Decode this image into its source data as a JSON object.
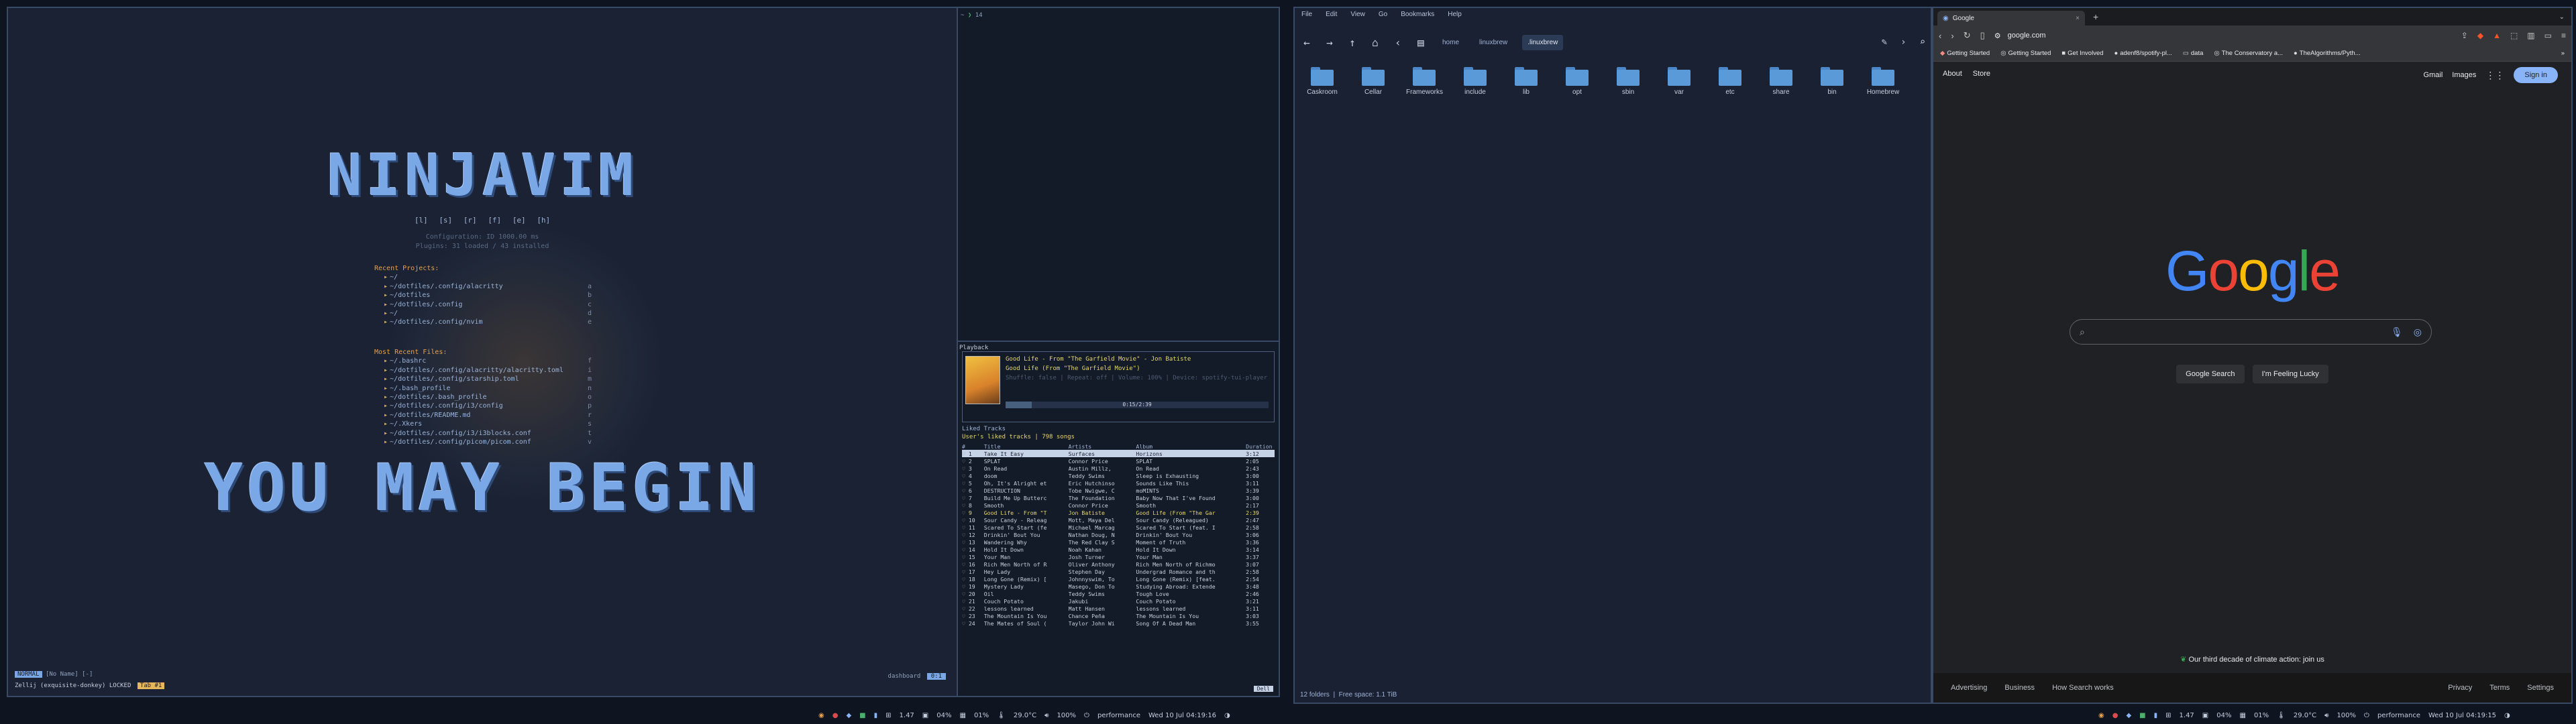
{
  "nvim": {
    "title_top": "NINJAVIM",
    "title_bottom": "YOU MAY BEGIN",
    "shortcuts": [
      "[l]",
      "[s]",
      "[r]",
      "[f]",
      "[e]",
      "[h]"
    ],
    "info_line1": "Configuration: ID 1000.00 ms",
    "info_line2": "Plugins: 31 loaded / 43 installed",
    "recent_header": "Recent Projects:",
    "recent": [
      {
        "path": "~/",
        "key": ""
      },
      {
        "path": "~/dotfiles/.config/alacritty",
        "key": "a"
      },
      {
        "path": "~/dotfiles",
        "key": "b"
      },
      {
        "path": "~/dotfiles/.config",
        "key": "c"
      },
      {
        "path": "~/",
        "key": "d"
      },
      {
        "path": "~/dotfiles/.config/nvim",
        "key": "e"
      }
    ],
    "mru_header": "Most Recent Files:",
    "mru": [
      {
        "path": "~/.bashrc",
        "key": "f"
      },
      {
        "path": "~/dotfiles/.config/alacritty/alacritty.toml",
        "key": "i"
      },
      {
        "path": "~/dotfiles/.config/starship.toml",
        "key": "m"
      },
      {
        "path": "~/.bash_profile",
        "key": "n"
      },
      {
        "path": "~/dotfiles/.bash_profile",
        "key": "o"
      },
      {
        "path": "~/dotfiles/.config/i3/config",
        "key": "p"
      },
      {
        "path": "~/dotfiles/README.md",
        "key": "r"
      },
      {
        "path": "~/.Xkers",
        "key": "s"
      },
      {
        "path": "~/dotfiles/.config/i3/i3blocks.conf",
        "key": "t"
      },
      {
        "path": "~/dotfiles/.config/picom/picom.conf",
        "key": "v"
      }
    ],
    "mode": "NORMAL",
    "buffer": "[No Name] [-]",
    "session": "Zellij (exquisite-donkey) LOCKED",
    "session_tag": "Tab #1",
    "right_label": "dashboard",
    "position": "0:1"
  },
  "terminal": {
    "prompt_dir": "~",
    "prompt_count": "14"
  },
  "spotify": {
    "box_label": "Playback",
    "line1": "Good Life - From \"The Garfield Movie\" - Jon Batiste",
    "line2": "Good Life (From \"The Garfield Movie\")",
    "line3": "Shuffle: false | Repeat: off | Volume: 100% | Device: spotify-tui-player",
    "progress_text": "0:15/2:39",
    "progress_fraction": 0.1,
    "lib_title": "Liked Tracks",
    "lib_sub": "User's liked tracks | 798 songs",
    "columns": [
      "#",
      "Title",
      "Artists",
      "Album",
      "Duration"
    ],
    "tracks": [
      [
        "1",
        "Take It Easy",
        "Surfaces",
        "Horizons",
        "3:12"
      ],
      [
        "2",
        "SPLAT",
        "Connor Price",
        "SPLAT",
        "2:05"
      ],
      [
        "3",
        "On Read",
        "Austin Millz,",
        "On Read",
        "2:43"
      ],
      [
        "4",
        "doom",
        "Teddy Swims",
        "Sleep is Exhausting",
        "3:00"
      ],
      [
        "5",
        "Oh, It's Alright et",
        "Eric Hutchinso",
        "Sounds Like This",
        "3:11"
      ],
      [
        "6",
        "DESTRUCTION",
        "Tobe Nwigwe, C",
        "moMINTS",
        "3:39"
      ],
      [
        "7",
        "Build Me Up Butterc",
        "The Foundation",
        "Baby Now That I've Found",
        "3:00"
      ],
      [
        "8",
        "Smooth",
        "Connor Price",
        "Smooth",
        "2:17"
      ],
      [
        "9",
        "Good Life - From \"T",
        "Jon Batiste",
        "Good Life (From \"The Gar",
        "2:39"
      ],
      [
        "10",
        "Sour Candy - Releag",
        "Mott, Maya Del",
        "Sour Candy (Releagued)",
        "2:47"
      ],
      [
        "11",
        "Scared To Start (fe",
        "Michael Marcag",
        "Scared To Start (feat. I",
        "2:58"
      ],
      [
        "12",
        "Drinkin' Bout You",
        "Nathan Doug, N",
        "Drinkin' Bout You",
        "3:06"
      ],
      [
        "13",
        "Wandering Why",
        "The Red Clay S",
        "Moment of Truth",
        "3:36"
      ],
      [
        "14",
        "Hold It Down",
        "Noah Kahan",
        "Hold It Down",
        "3:14"
      ],
      [
        "15",
        "Your Man",
        "Josh Turner",
        "Your Man",
        "3:37"
      ],
      [
        "16",
        "Rich Men North of R",
        "Oliver Anthony",
        "Rich Men North of Richmo",
        "3:07"
      ],
      [
        "17",
        "Hey Lady",
        "Stephen Day",
        "Undergrad Romance and th",
        "2:58"
      ],
      [
        "18",
        "Long Gone (Remix) [",
        "Johnnyswim, To",
        "Long Gone (Remix) [feat.",
        "2:54"
      ],
      [
        "19",
        "Mystery Lady",
        "Masego, Don To",
        "Studying Abroad: Extende",
        "3:48"
      ],
      [
        "20",
        "Oil",
        "Teddy Swims",
        "Tough Love",
        "2:46"
      ],
      [
        "21",
        "Couch Potato",
        "Jakubi",
        "Couch Potato",
        "3:21"
      ],
      [
        "22",
        "lessons learned",
        "Matt Hansen",
        "lessons learned",
        "3:11"
      ],
      [
        "23",
        "The Mountain Is You",
        "Chance Peña",
        "The Mountain Is You",
        "3:03"
      ],
      [
        "24",
        "The Mates of Soul (",
        "Taylor John Wi",
        "Song Of A Dead Man",
        "3:55"
      ]
    ],
    "selected_index": 0,
    "playing_index": 8,
    "footer": "Dell"
  },
  "files": {
    "menu": [
      "File",
      "Edit",
      "View",
      "Go",
      "Bookmarks",
      "Help"
    ],
    "crumbs": [
      "home",
      "linuxbrew",
      ".linuxbrew"
    ],
    "folders": [
      "Caskroom",
      "Cellar",
      "Frameworks",
      "include",
      "lib",
      "opt",
      "sbin",
      "var",
      "etc",
      "share",
      "bin",
      "Homebrew"
    ],
    "status_count": "12 folders",
    "status_free": "Free space: 1.1 TiB"
  },
  "chrome": {
    "tab_title": "Google",
    "url": "google.com",
    "bookmarks": [
      "Getting Started",
      "Getting Started",
      "Get Involved",
      "adenf8/spotify-pl...",
      "data",
      "The Conservatory a...",
      "TheAlgorithms/Pyth..."
    ],
    "top_left": [
      "About",
      "Store"
    ],
    "top_right": [
      "Gmail",
      "Images"
    ],
    "signin": "Sign in",
    "logo_letters": [
      {
        "ch": "G",
        "color": "#4285f4"
      },
      {
        "ch": "o",
        "color": "#ea4335"
      },
      {
        "ch": "o",
        "color": "#fbbc05"
      },
      {
        "ch": "g",
        "color": "#4285f4"
      },
      {
        "ch": "l",
        "color": "#34a853"
      },
      {
        "ch": "e",
        "color": "#ea4335"
      }
    ],
    "btn_search": "Google Search",
    "btn_lucky": "I'm Feeling Lucky",
    "climate": "Our third decade of climate action: join us",
    "footer_left": [
      "Advertising",
      "Business",
      "How Search works"
    ],
    "footer_right": [
      "Privacy",
      "Terms",
      "Settings"
    ]
  },
  "bars": {
    "load": "1.47",
    "cpu": "04%",
    "mem": "01%",
    "temp": "29.0°C",
    "volume": "100%",
    "governor": "performance",
    "clock_left": "Wed 10 Jul 04:19:16",
    "clock_right": "Wed 10 Jul 04:19:15"
  }
}
